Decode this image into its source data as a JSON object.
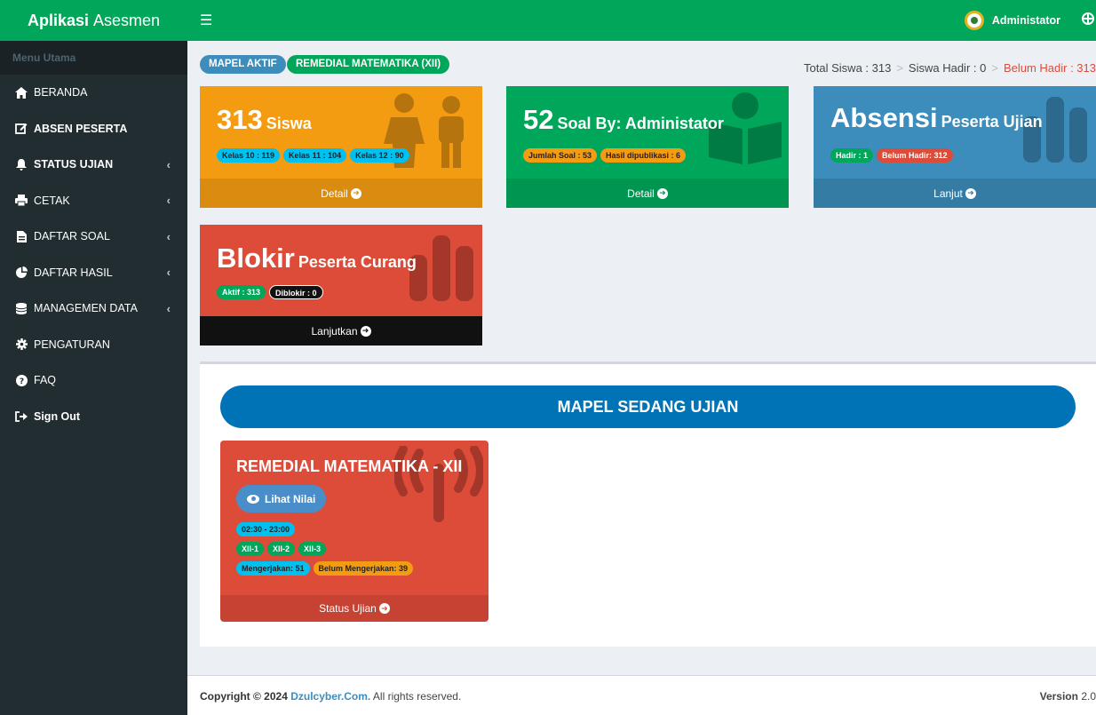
{
  "app": {
    "brand_bold": "Aplikasi",
    "brand_rest": "Asesmen"
  },
  "sidebar": {
    "header": "Menu Utama",
    "items": [
      {
        "label": "BERANDA",
        "icon": "home-icon"
      },
      {
        "label": "ABSEN PESERTA",
        "icon": "edit-icon"
      },
      {
        "label": "STATUS UJIAN",
        "icon": "bell-icon",
        "chevron": "‹"
      },
      {
        "label": "CETAK",
        "icon": "print-icon",
        "chevron": "‹"
      },
      {
        "label": "DAFTAR SOAL",
        "icon": "file-icon",
        "chevron": "‹"
      },
      {
        "label": "DAFTAR HASIL",
        "icon": "pie-chart-icon",
        "chevron": "‹"
      },
      {
        "label": "MANAGEMEN DATA",
        "icon": "database-icon",
        "chevron": "‹"
      },
      {
        "label": "PENGATURAN",
        "icon": "gear-icon"
      },
      {
        "label": "FAQ",
        "icon": "question-icon"
      },
      {
        "label": "Sign Out",
        "icon": "sign-out-icon"
      }
    ]
  },
  "topbar": {
    "user": "Administator"
  },
  "pills": {
    "mapel_aktif": "MAPEL AKTIF",
    "remedial": "REMEDIAL MATEMATIKA (XII)"
  },
  "stats": {
    "total": "Total Siswa : 313",
    "hadir": "Siswa Hadir : 0",
    "belum": "Belum Hadir : 313",
    "sep": ">"
  },
  "boxes": {
    "siswa": {
      "number": "313",
      "unit": "Siswa",
      "badges": [
        "Kelas 10 : 119",
        "Kelas 11 : 104",
        "Kelas 12 : 90"
      ],
      "footer": "Detail"
    },
    "soal": {
      "number": "52",
      "unit": "Soal By: Administator",
      "badges": [
        "Jumlah Soal : 53",
        "Hasil dipublikasi : 6"
      ],
      "footer": "Detail"
    },
    "absensi": {
      "number": "Absensi",
      "unit": "Peserta Ujian",
      "badges": [
        "Hadir : 1",
        "Belum Hadir: 312"
      ],
      "footer": "Lanjut"
    },
    "blokir": {
      "number": "Blokir",
      "unit": "Peserta Curang",
      "badges": [
        "Aktif : 313",
        "Diblokir : 0"
      ],
      "footer": "Lanjutkan"
    }
  },
  "panel": {
    "banner": "MAPEL SEDANG UJIAN",
    "exam": {
      "title": "REMEDIAL MATEMATIKA - XII",
      "lihat": "Lihat Nilai",
      "time": "02:30 - 23:00",
      "classes": [
        "XII-1",
        "XII-2",
        "XII-3"
      ],
      "mengerjakan": "Mengerjakan: 51",
      "belum": "Belum Mengerjakan: 39",
      "footer": "Status Ujian"
    }
  },
  "footer": {
    "copyright": "Copyright © 2024",
    "site": "Dzulcyber.Com.",
    "rights": "All rights reserved.",
    "version_label": "Version",
    "version": "2.0"
  },
  "colors": {
    "green": "#00a65a",
    "orange": "#f39c12",
    "blue": "#3c8dbc",
    "red": "#dd4b39",
    "sidebar": "#222d32"
  }
}
